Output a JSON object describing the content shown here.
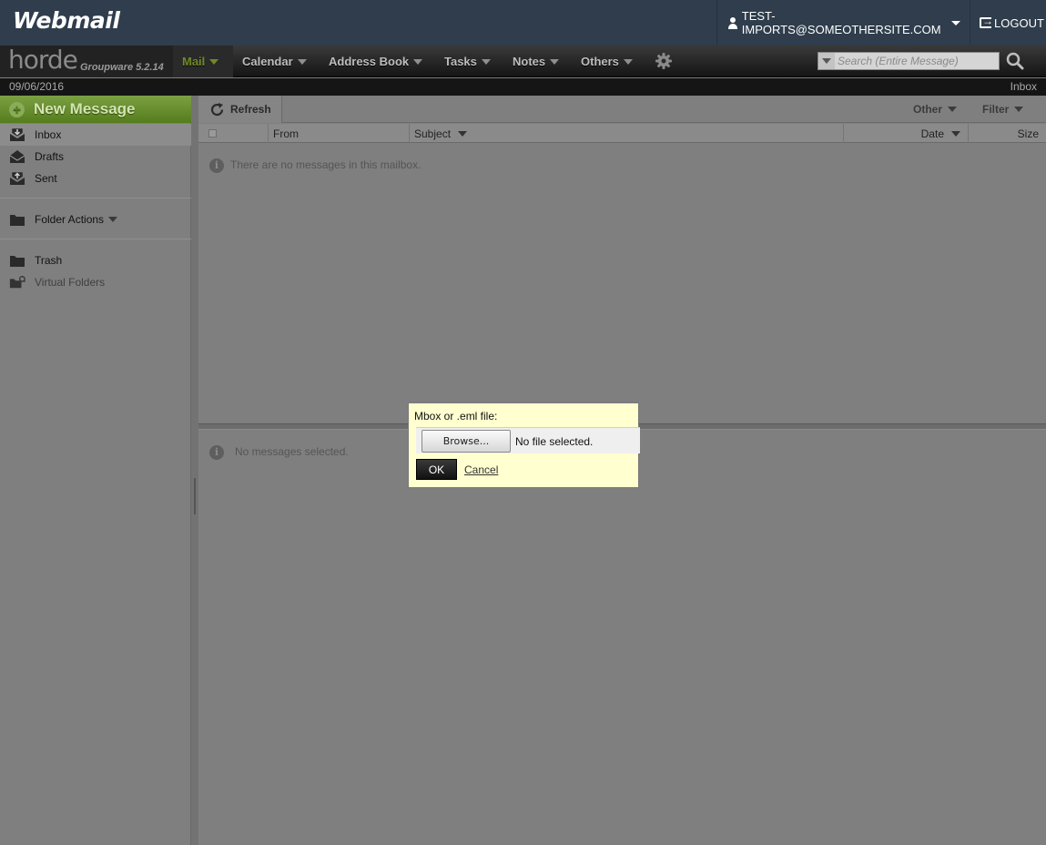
{
  "header": {
    "logo": "Webmail",
    "user": "TEST-IMPORTS@SOMEOTHERSITE.COM",
    "logout": "LOGOUT"
  },
  "nav": {
    "brand": "horde",
    "version": "Groupware 5.2.14",
    "items": [
      {
        "label": "Mail"
      },
      {
        "label": "Calendar"
      },
      {
        "label": "Address Book"
      },
      {
        "label": "Tasks"
      },
      {
        "label": "Notes"
      },
      {
        "label": "Others"
      }
    ],
    "search_placeholder": "Search (Entire Message)"
  },
  "infobar": {
    "date": "09/06/2016",
    "location": "Inbox"
  },
  "sidebar": {
    "new_message": "New Message",
    "folders": [
      {
        "label": "Inbox",
        "icon": "inbox-icon"
      },
      {
        "label": "Drafts",
        "icon": "drafts-icon"
      },
      {
        "label": "Sent",
        "icon": "sent-icon"
      }
    ],
    "folder_actions": "Folder Actions",
    "other_folders": [
      {
        "label": "Trash",
        "icon": "folder-icon"
      },
      {
        "label": "Virtual Folders",
        "icon": "virtual-folder-icon"
      }
    ]
  },
  "toolbar": {
    "refresh": "Refresh",
    "other": "Other",
    "filter": "Filter"
  },
  "list": {
    "columns": {
      "from": "From",
      "subject": "Subject",
      "date": "Date",
      "size": "Size"
    },
    "empty": "There are no messages in this mailbox."
  },
  "preview": {
    "empty": "No messages selected."
  },
  "dialog": {
    "label": "Mbox or .eml file:",
    "browse": "Browse...",
    "file_status": "No file selected.",
    "ok": "OK",
    "cancel": "Cancel"
  }
}
